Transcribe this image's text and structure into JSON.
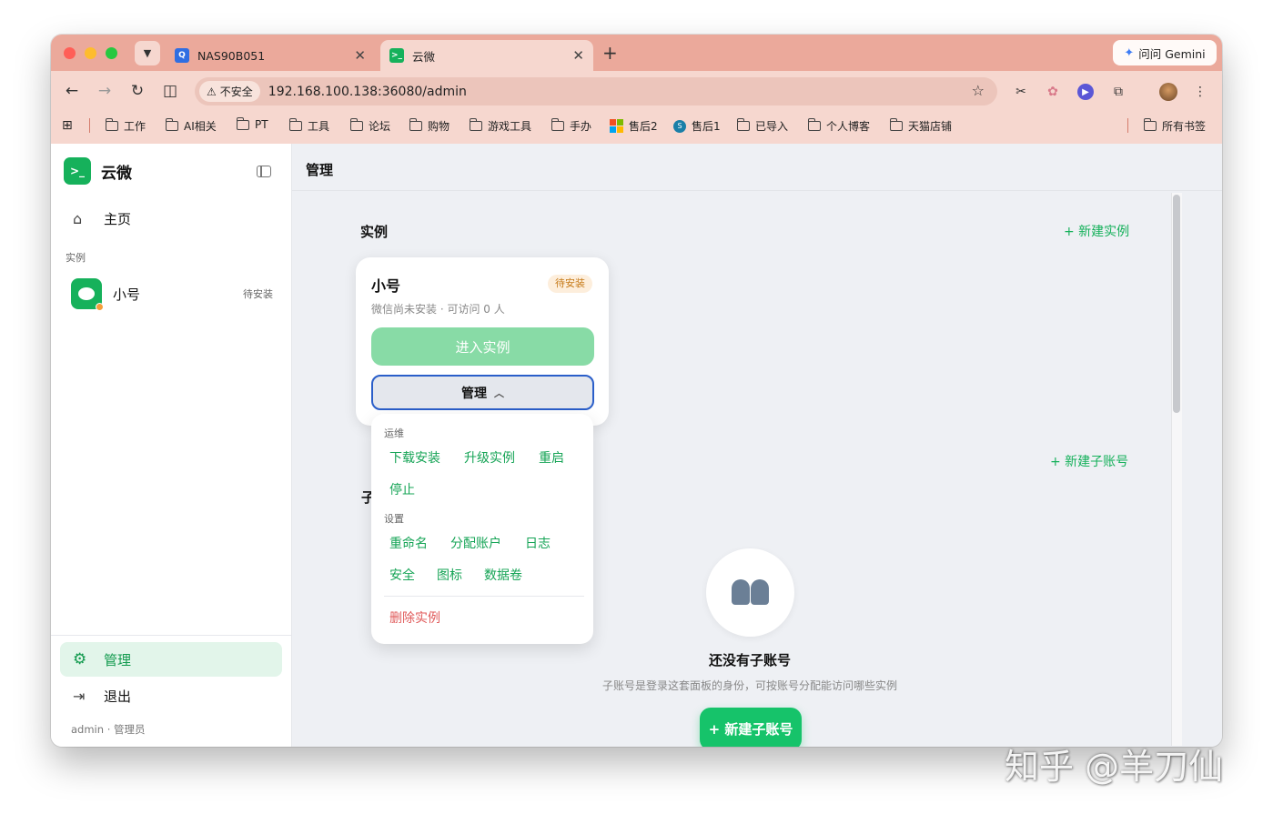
{
  "browser": {
    "tabs": [
      {
        "title": "NAS90B051",
        "icon": "nas-favicon"
      },
      {
        "title": "云微",
        "icon": "yunwei-favicon"
      }
    ],
    "gemini_label": "问问 Gemini",
    "security_label": "不安全",
    "url": "192.168.100.138:36080/admin",
    "bookmarks": [
      "工作",
      "AI相关",
      "PT",
      "工具",
      "论坛",
      "购物",
      "游戏工具",
      "手办",
      "售后2",
      "售后1",
      "已导入",
      "个人博客",
      "天猫店铺"
    ],
    "all_bookmarks": "所有书签"
  },
  "sidebar": {
    "brand": "云微",
    "home": "主页",
    "section_label": "实例",
    "instance": {
      "name": "小号",
      "status": "待安装"
    },
    "manage": "管理",
    "logout": "退出",
    "user": "admin · 管理员"
  },
  "main": {
    "title": "管理",
    "instances_title": "实例",
    "new_instance": "+ 新建实例",
    "card": {
      "name": "小号",
      "badge": "待安装",
      "desc": "微信尚未安装 · 可访问 0 人",
      "enter": "进入实例",
      "manage": "管理"
    },
    "menu": {
      "ops_label": "运维",
      "ops": [
        "下载安装",
        "升级实例",
        "重启",
        "停止"
      ],
      "settings_label": "设置",
      "settings": [
        "重命名",
        "分配账户",
        "日志",
        "安全",
        "图标",
        "数据卷"
      ],
      "delete": "删除实例"
    },
    "subaccounts_partial": "子",
    "new_subaccount_link": "+ 新建子账号",
    "empty_title": "还没有子账号",
    "empty_desc": "子账号是登录这套面板的身份，可按账号分配能访问哪些实例",
    "new_subaccount_button": "+ 新建子账号"
  },
  "watermark": "知乎 @羊刀仙",
  "colors": {
    "accent": "#16b15b",
    "danger": "#e05a5a",
    "chrome": "#f6d7cf",
    "tabstrip": "#eba99b"
  }
}
